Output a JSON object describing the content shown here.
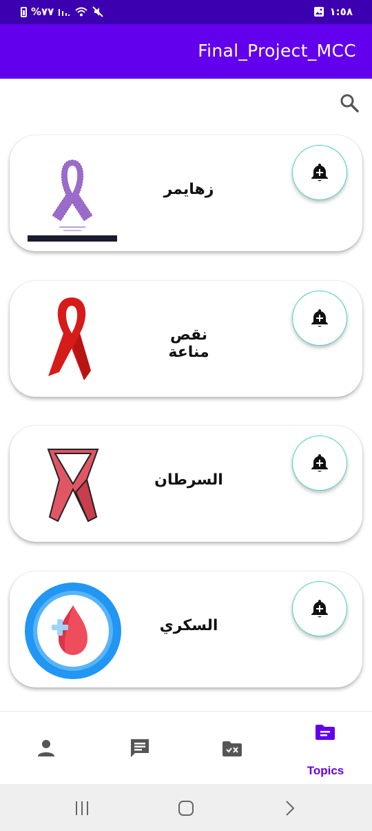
{
  "status_bar": {
    "battery": "%٧٧",
    "time": "١:٥٨"
  },
  "app_bar": {
    "title": "Final_Project_MCC"
  },
  "icons": {
    "search": "search-icon",
    "notify": "bell-plus-icon"
  },
  "cards": [
    {
      "title": "زهايمر",
      "image": "purple-ribbon-icon"
    },
    {
      "title": "نقص مناعة",
      "image": "red-ribbon-icon"
    },
    {
      "title": "السرطان",
      "image": "pink-ribbon-icon"
    },
    {
      "title": "السكري",
      "image": "blood-drop-icon"
    }
  ],
  "bottom_nav": {
    "items": [
      {
        "icon": "person-icon",
        "label": ""
      },
      {
        "icon": "message-icon",
        "label": ""
      },
      {
        "icon": "folder-x-icon",
        "label": ""
      },
      {
        "icon": "topics-icon",
        "label": "Topics",
        "selected": true
      }
    ]
  },
  "colors": {
    "status_bar": "#3d00b0",
    "app_bar": "#6200ee",
    "accent": "#6200ee",
    "fab_border": "#4fd0c7"
  }
}
